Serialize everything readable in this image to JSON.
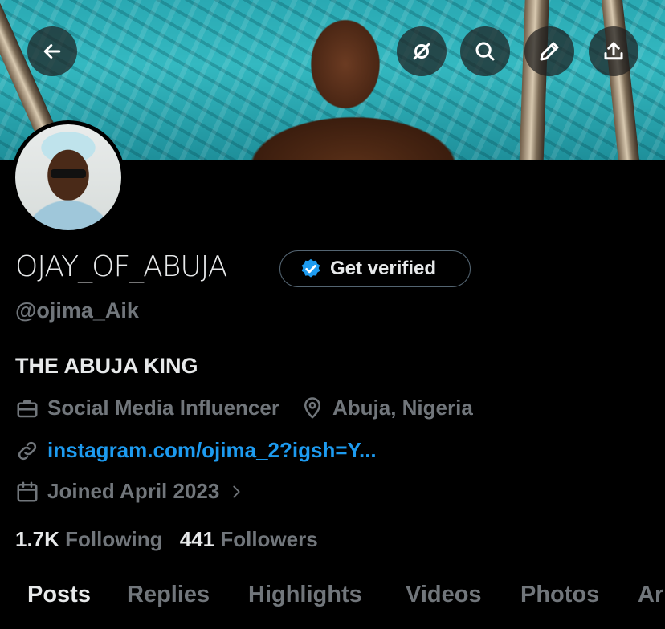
{
  "header": {
    "buttons": [
      {
        "name": "back-button",
        "icon": "arrow-left-icon"
      },
      {
        "name": "grok-button",
        "icon": "grok-icon"
      },
      {
        "name": "search-button",
        "icon": "search-icon"
      },
      {
        "name": "edit-button",
        "icon": "pencil-icon"
      },
      {
        "name": "share-button",
        "icon": "share-icon"
      }
    ]
  },
  "profile": {
    "display_name": "OJAY_OF_ABUJA",
    "verify_label": "Get verified",
    "handle": "@ojima_Aik",
    "bio": "THE ABUJA KING",
    "category": "Social Media Influencer",
    "location": "Abuja, Nigeria",
    "website": "instagram.com/ojima_2?igsh=Y...",
    "joined": "Joined April 2023",
    "following_count": "1.7K",
    "following_label": "Following",
    "followers_count": "441",
    "followers_label": "Followers"
  },
  "tabs": [
    {
      "label": "Posts",
      "active": true
    },
    {
      "label": "Replies",
      "active": false
    },
    {
      "label": "Highlights",
      "active": false
    },
    {
      "label": "Videos",
      "active": false
    },
    {
      "label": "Photos",
      "active": false
    },
    {
      "label": "Ar",
      "active": false
    }
  ],
  "colors": {
    "background": "#000000",
    "accent": "#1d9bf0",
    "muted": "#71767b",
    "text": "#e7e9ea"
  }
}
